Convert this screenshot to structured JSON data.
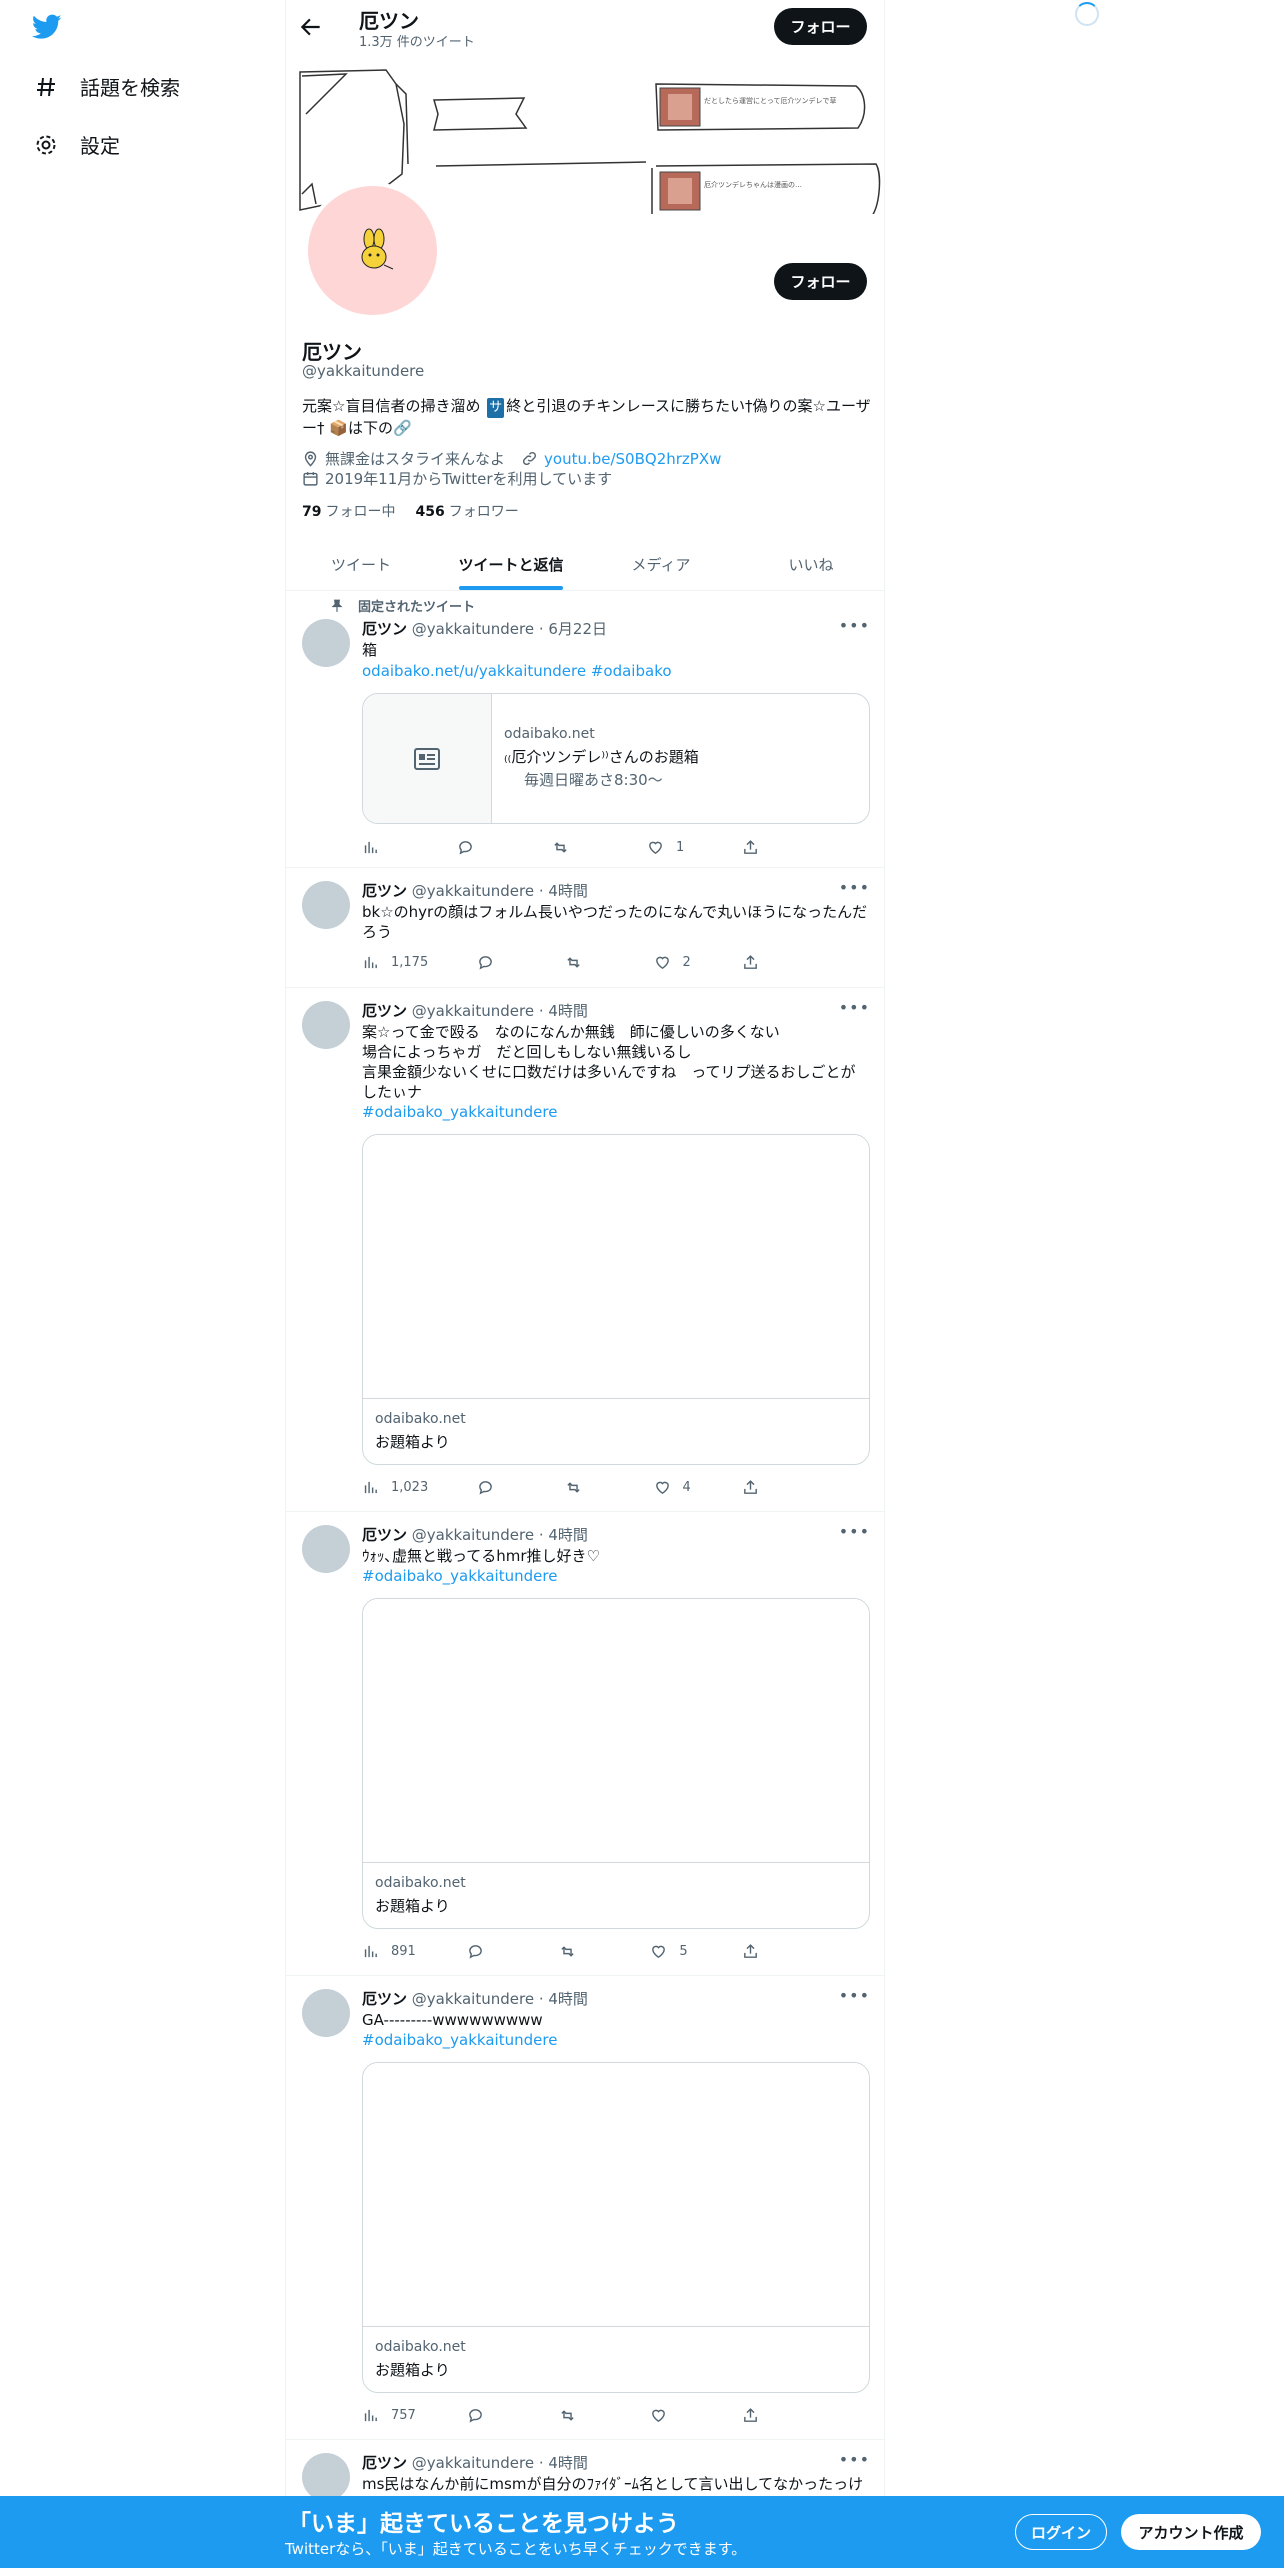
{
  "nav": {
    "explore_label": "話題を検索",
    "settings_label": "設定"
  },
  "header": {
    "name": "厄ツン",
    "tweet_count": "1.3万 件のツイート",
    "follow_label": "フォロー"
  },
  "banner": {
    "box1_text": "だとしたら運営にとって厄介ツンデレで草",
    "box2_text": "厄介ツンデレちゃんは漫画の…"
  },
  "profile": {
    "name": "厄ツン",
    "handle": "@yakkaitundere",
    "bio_part1": "元案☆盲目信者の掃き溜め ",
    "bio_square": "サ",
    "bio_part2": "終と引退のチキンレースに勝ちたい†偽りの案☆ユーザー† 📦は下の🔗",
    "location": "無課金はスタライ来んなよ",
    "url": "youtu.be/S0BQ2hrzPXw",
    "joined": "2019年11月からTwitterを利用しています",
    "following_count": "79",
    "following_label": "フォロー中",
    "followers_count": "456",
    "followers_label": "フォロワー",
    "follow_label": "フォロー"
  },
  "tabs": [
    {
      "label": "ツイート"
    },
    {
      "label": "ツイートと返信"
    },
    {
      "label": "メディア"
    },
    {
      "label": "いいね"
    }
  ],
  "pinned_label": "固定されたツイート",
  "tweets": [
    {
      "name": "厄ツン",
      "handle": "@yakkaitundere",
      "time": "6月22日",
      "text": "箱",
      "links": "odaibako.net/u/yakkaitundere #odaibako",
      "card_domain": "odaibako.net",
      "card_title": "₍₍厄介ツンデレ⁾⁾さんのお題箱",
      "card_sub": "毎週日曜あさ8:30〜",
      "views": "",
      "likes": "1"
    },
    {
      "name": "厄ツン",
      "handle": "@yakkaitundere",
      "time": "4時間",
      "text": "bk☆のhyrの顔はフォルム長いやつだったのになんで丸いほうになったんだろう",
      "views": "1,175",
      "likes": "2"
    },
    {
      "name": "厄ツン",
      "handle": "@yakkaitundere",
      "time": "4時間",
      "line1": "案☆って金で殴る　なのになんか無銭　師に優しいの多くない",
      "line2": "場合によっちゃガ　だと回しもしない無銭いるし",
      "line3": "言果金額少ないくせに口数だけは多いんですね　ってリプ送るおしごとがしたぃナ",
      "hashtag": "#odaibako_yakkaitundere",
      "card_domain": "odaibako.net",
      "card_title": "お題箱より",
      "views": "1,023",
      "likes": "4"
    },
    {
      "name": "厄ツン",
      "handle": "@yakkaitundere",
      "time": "4時間",
      "text": "ｳｫｯ､虚無と戦ってるhmr推し好き♡",
      "hashtag": "#odaibako_yakkaitundere",
      "card_domain": "odaibako.net",
      "card_title": "お題箱より",
      "views": "891",
      "likes": "5"
    },
    {
      "name": "厄ツン",
      "handle": "@yakkaitundere",
      "time": "4時間",
      "text": "GA---------wwwwwwwww",
      "hashtag": "#odaibako_yakkaitundere",
      "card_domain": "odaibako.net",
      "card_title": "お題箱より",
      "views": "757",
      "likes": ""
    },
    {
      "name": "厄ツン",
      "handle": "@yakkaitundere",
      "time": "4時間",
      "text": "ms民はなんか前にmsmが自分のﾌｧｲﾀﾞｰﾑ名として言い出してなかったっけ"
    }
  ],
  "bottom": {
    "headline": "「いま」起きていることを見つけよう",
    "sub": "Twitterなら、「いま」起きていることをいち早くチェックできます。",
    "login": "ログイン",
    "signup": "アカウント作成"
  },
  "colors": {
    "brand": "#1d9bf0",
    "dark": "#0f1419",
    "muted": "#536471"
  }
}
